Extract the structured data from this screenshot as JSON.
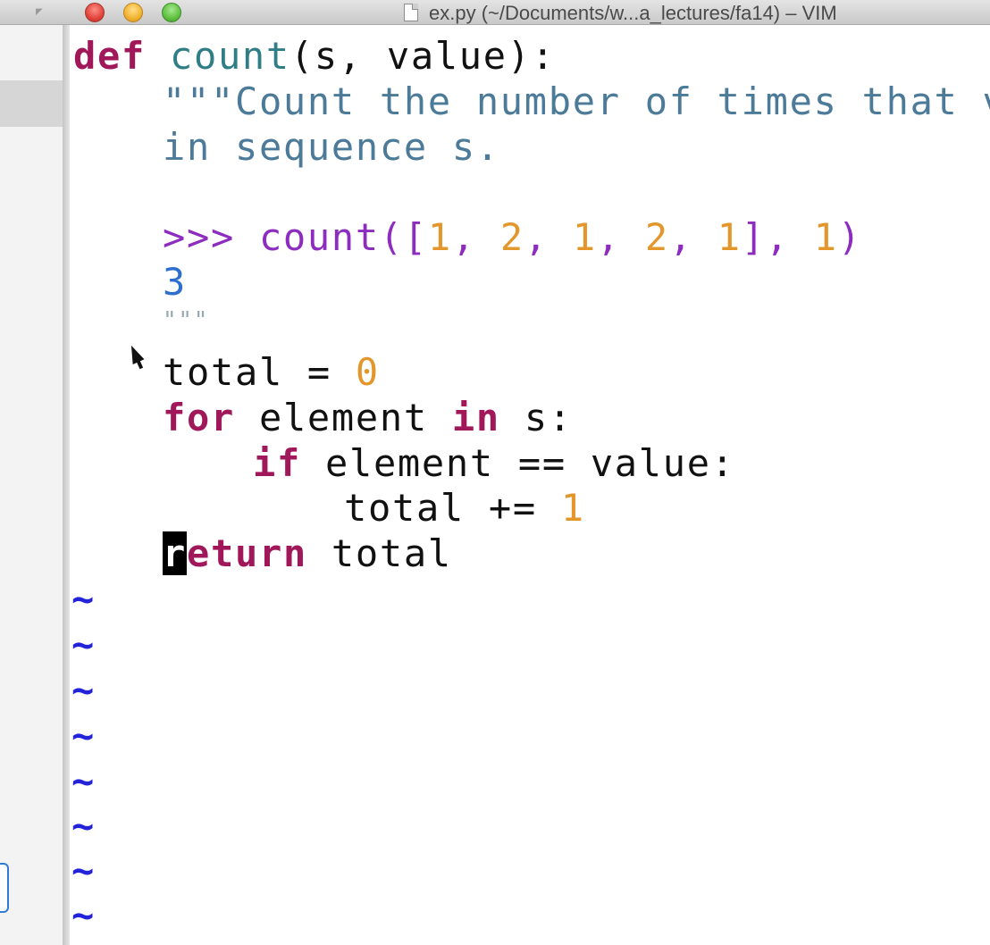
{
  "window": {
    "title": "ex.py (~/Documents/w...a_lectures/fa14) – VIM",
    "buttons": [
      "close",
      "minimize",
      "zoom"
    ],
    "icon": "document-icon"
  },
  "editor": {
    "mode": "normal",
    "cursor_char": "r",
    "lines": [
      {
        "def": "def",
        "fn": "count",
        "rest": "(s, value):"
      },
      {
        "doc": "\"\"\"Count the number of times that val"
      },
      {
        "doc": "in sequence s."
      },
      {
        "doc": ""
      },
      {
        "prompt": ">>> count([",
        "n1": "1",
        "c1": ", ",
        "n2": "2",
        "c2": ", ",
        "n3": "1",
        "c3": ", ",
        "n4": "2",
        "c4": ", ",
        "n5": "1",
        "c5": "], ",
        "n6": "1",
        "c6": ")"
      },
      {
        "out": "3"
      },
      {
        "quote": "\"\"\""
      },
      {
        "text": "total = ",
        "num": "0"
      },
      {
        "kw1": "for",
        "mid": " element ",
        "kw2": "in",
        "end": " s:"
      },
      {
        "kw": "if",
        "rest": " element == value:"
      },
      {
        "text": "total += ",
        "num": "1"
      },
      {
        "cursor": "r",
        "kw": "eturn",
        "rest": " total"
      }
    ],
    "tilde": "~",
    "tilde_count": 8
  },
  "colors": {
    "keyword": "#a0185a",
    "function": "#2f7d85",
    "docstring": "#4c7a99",
    "number": "#e3962a",
    "prompt": "#8c2dbf",
    "tilde": "#2324d9"
  }
}
